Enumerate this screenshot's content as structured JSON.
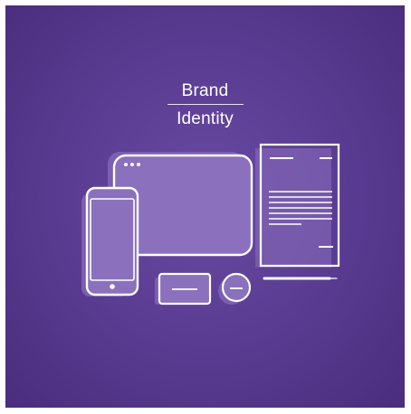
{
  "card": {
    "title_line1": "Brand",
    "title_line2": "Identity",
    "background": "#5b3d93",
    "stroke_color": "#ffffff",
    "fill_color": "#8b70be",
    "icons": [
      "desktop-monitor-icon",
      "smartphone-icon",
      "letterhead-document-icon",
      "business-card-icon",
      "badge-icon",
      "pen-icon"
    ]
  }
}
